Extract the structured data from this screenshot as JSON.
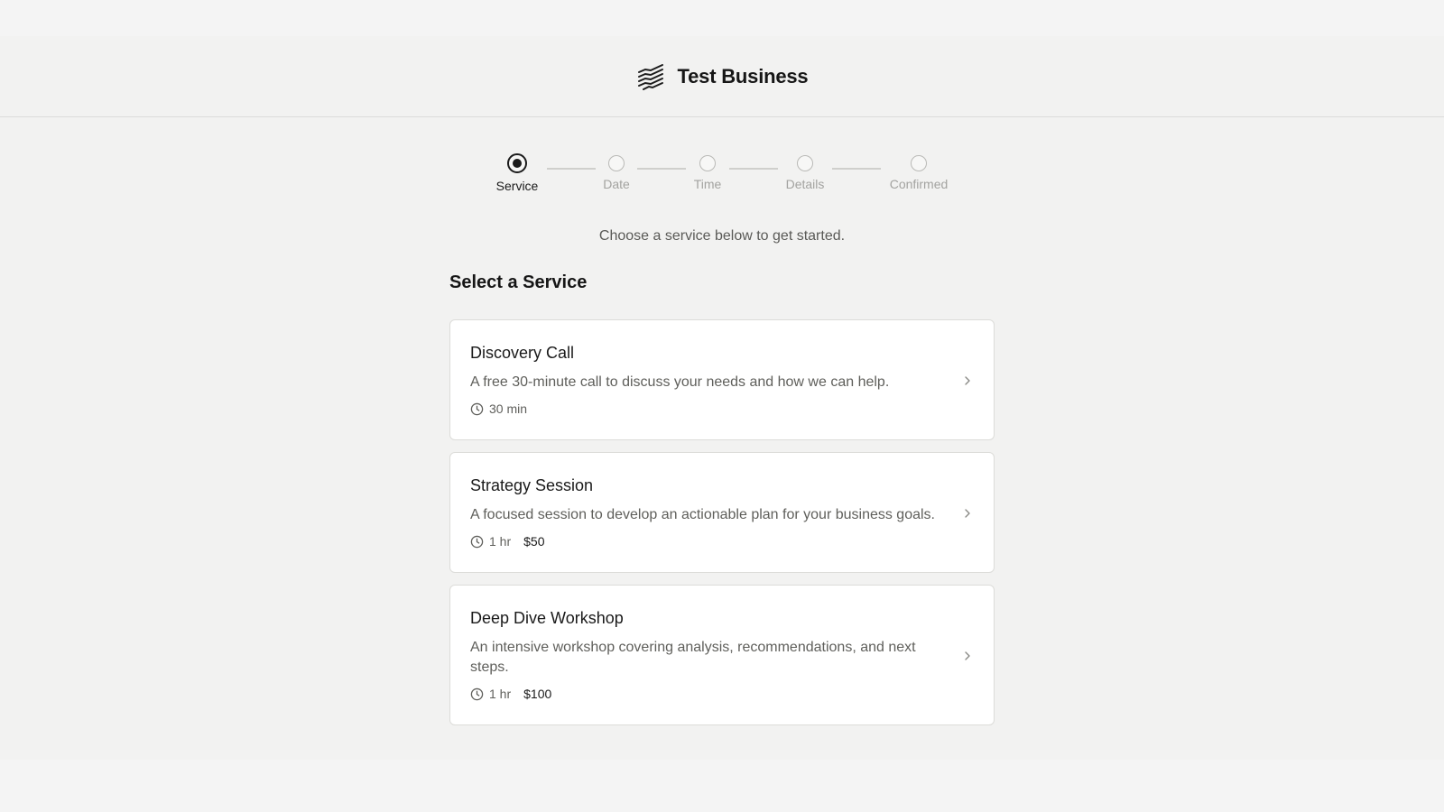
{
  "header": {
    "business_name": "Test Business",
    "logo_icon": "waves-logo-icon"
  },
  "stepper": {
    "steps": [
      {
        "label": "Service",
        "state": "active"
      },
      {
        "label": "Date",
        "state": "pending"
      },
      {
        "label": "Time",
        "state": "pending"
      },
      {
        "label": "Details",
        "state": "pending"
      },
      {
        "label": "Confirmed",
        "state": "pending"
      }
    ]
  },
  "intro_text": "Choose a service below to get started.",
  "section_title": "Select a Service",
  "services": [
    {
      "title": "Discovery Call",
      "description": "A free 30-minute call to discuss your needs and how we can help.",
      "duration": "30 min",
      "price": ""
    },
    {
      "title": "Strategy Session",
      "description": "A focused session to develop an actionable plan for your business goals.",
      "duration": "1 hr",
      "price": "$50"
    },
    {
      "title": "Deep Dive Workshop",
      "description": "An intensive workshop covering analysis, recommendations, and next steps.",
      "duration": "1 hr",
      "price": "$100"
    }
  ],
  "colors": {
    "page_bg": "#f2f2f1",
    "card_bg": "#ffffff",
    "text": "#1b1b1b",
    "muted": "#5f5f5b",
    "inactive": "#a3a3a0"
  }
}
